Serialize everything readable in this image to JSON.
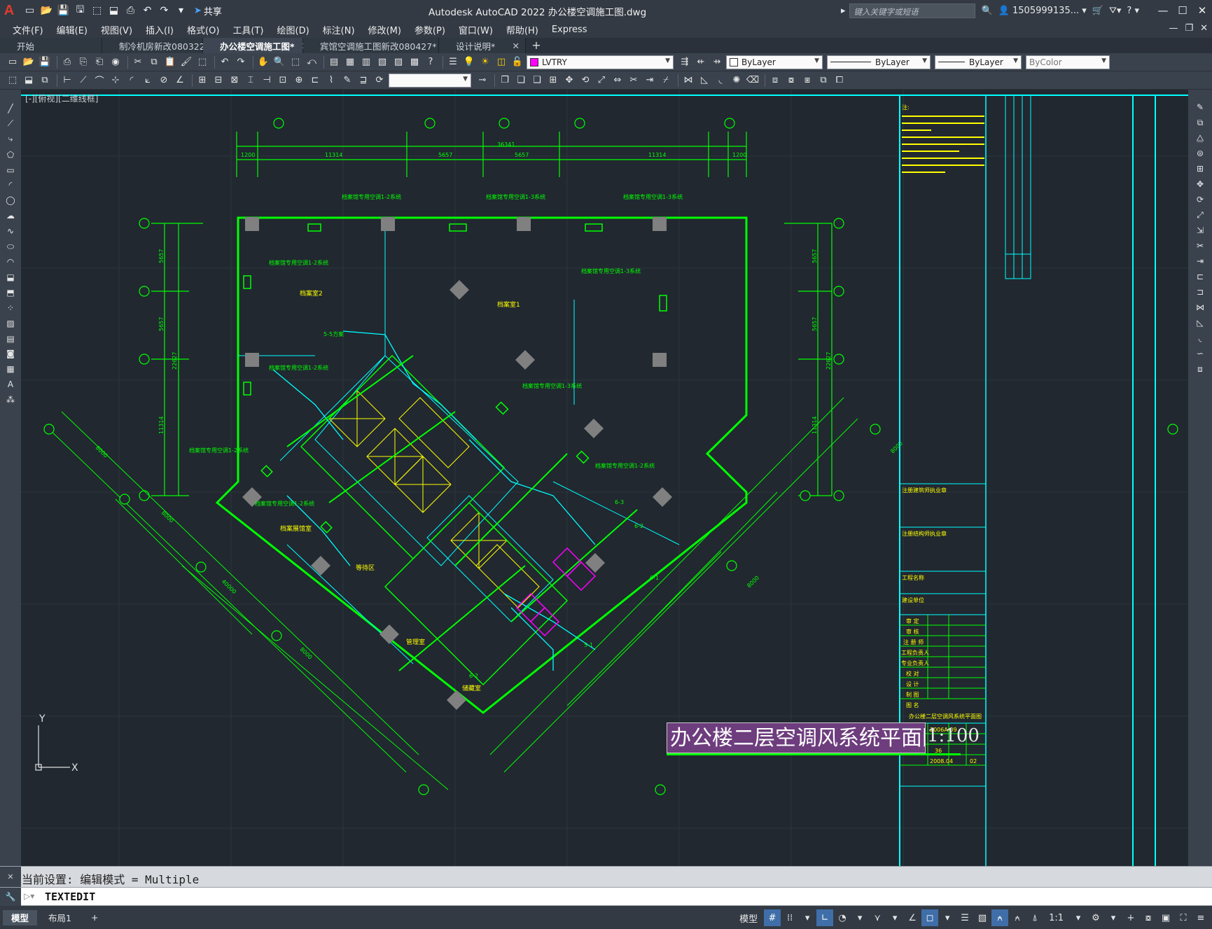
{
  "app": {
    "logo": "A",
    "share_label": "共享",
    "title": "Autodesk AutoCAD 2022    办公楼空调施工图.dwg",
    "search_placeholder": "键入关键字或短语",
    "user": "1505999135...",
    "help": "?"
  },
  "menu": {
    "items": [
      "文件(F)",
      "编辑(E)",
      "视图(V)",
      "插入(I)",
      "格式(O)",
      "工具(T)",
      "绘图(D)",
      "标注(N)",
      "修改(M)",
      "参数(P)",
      "窗口(W)",
      "帮助(H)",
      "Express"
    ]
  },
  "tabs": {
    "items": [
      {
        "label": "开始",
        "closable": false,
        "active": false
      },
      {
        "label": "制冷机房新改080322",
        "closable": true,
        "active": false
      },
      {
        "label": "办公楼空调施工图*",
        "closable": true,
        "active": true
      },
      {
        "label": "宾馆空调施工图新改080427*",
        "closable": true,
        "active": false
      },
      {
        "label": "设计说明*",
        "closable": true,
        "active": false
      }
    ],
    "add_label": "+"
  },
  "toolbar": {
    "layer_name": "LVTRY",
    "layer_color": "#ff00ff",
    "color_combo": "ByLayer",
    "linetype_combo": "ByLayer",
    "lineweight_combo": "ByLayer",
    "plotstyle_combo": "ByColor"
  },
  "canvas": {
    "view_label": "[-][俯视][二维线框]",
    "drawing_title": "办公楼二层空调风系统平面图",
    "scale_label": "1:100",
    "dims_top": [
      "1200",
      "11314",
      "5657",
      "5657",
      "11314",
      "1200"
    ],
    "dim_total_top": "36341",
    "dims_left": [
      "5657",
      "5657",
      "11314"
    ],
    "dim_total_left": "22627",
    "grid_dims_diag": [
      "8000",
      "8000",
      "40000",
      "8000",
      "8000",
      "8000"
    ],
    "rooms": [
      "档案室2",
      "档案室1",
      "等待区",
      "管理室",
      "档案展馆室",
      "储藏室"
    ],
    "sections": [
      "5-5方案",
      "6-1",
      "6-2",
      "6-3",
      "5-1",
      "6-2"
    ],
    "notes_label": "注:",
    "title_block": {
      "rows": [
        "审 定",
        "审 核",
        "注 册 师",
        "工程负责人",
        "专业负责人",
        "校 对",
        "设 计",
        "制 图",
        "图 名"
      ],
      "sheet_name": "办公楼二层空调风系统平面图",
      "project_no": "2006A-09",
      "drawing_no": "36",
      "date": "2008.04",
      "version": "02",
      "label_project": "工程名称",
      "label_client": "建设单位",
      "label_arch": "注册建筑师执业章",
      "label_struct": "注册结构师执业章"
    }
  },
  "command": {
    "history": "当前设置: 编辑模式 = Multiple",
    "current": "TEXTEDIT"
  },
  "status": {
    "layout_tabs": [
      "模型",
      "布局1"
    ],
    "model_label": "模型",
    "scale": "1:1"
  },
  "colors": {
    "accent_green": "#00ff00",
    "cyan": "#00ffff",
    "yellow": "#ffff00",
    "magenta": "#ff00ff",
    "title_bg": "#6d3d7d"
  }
}
